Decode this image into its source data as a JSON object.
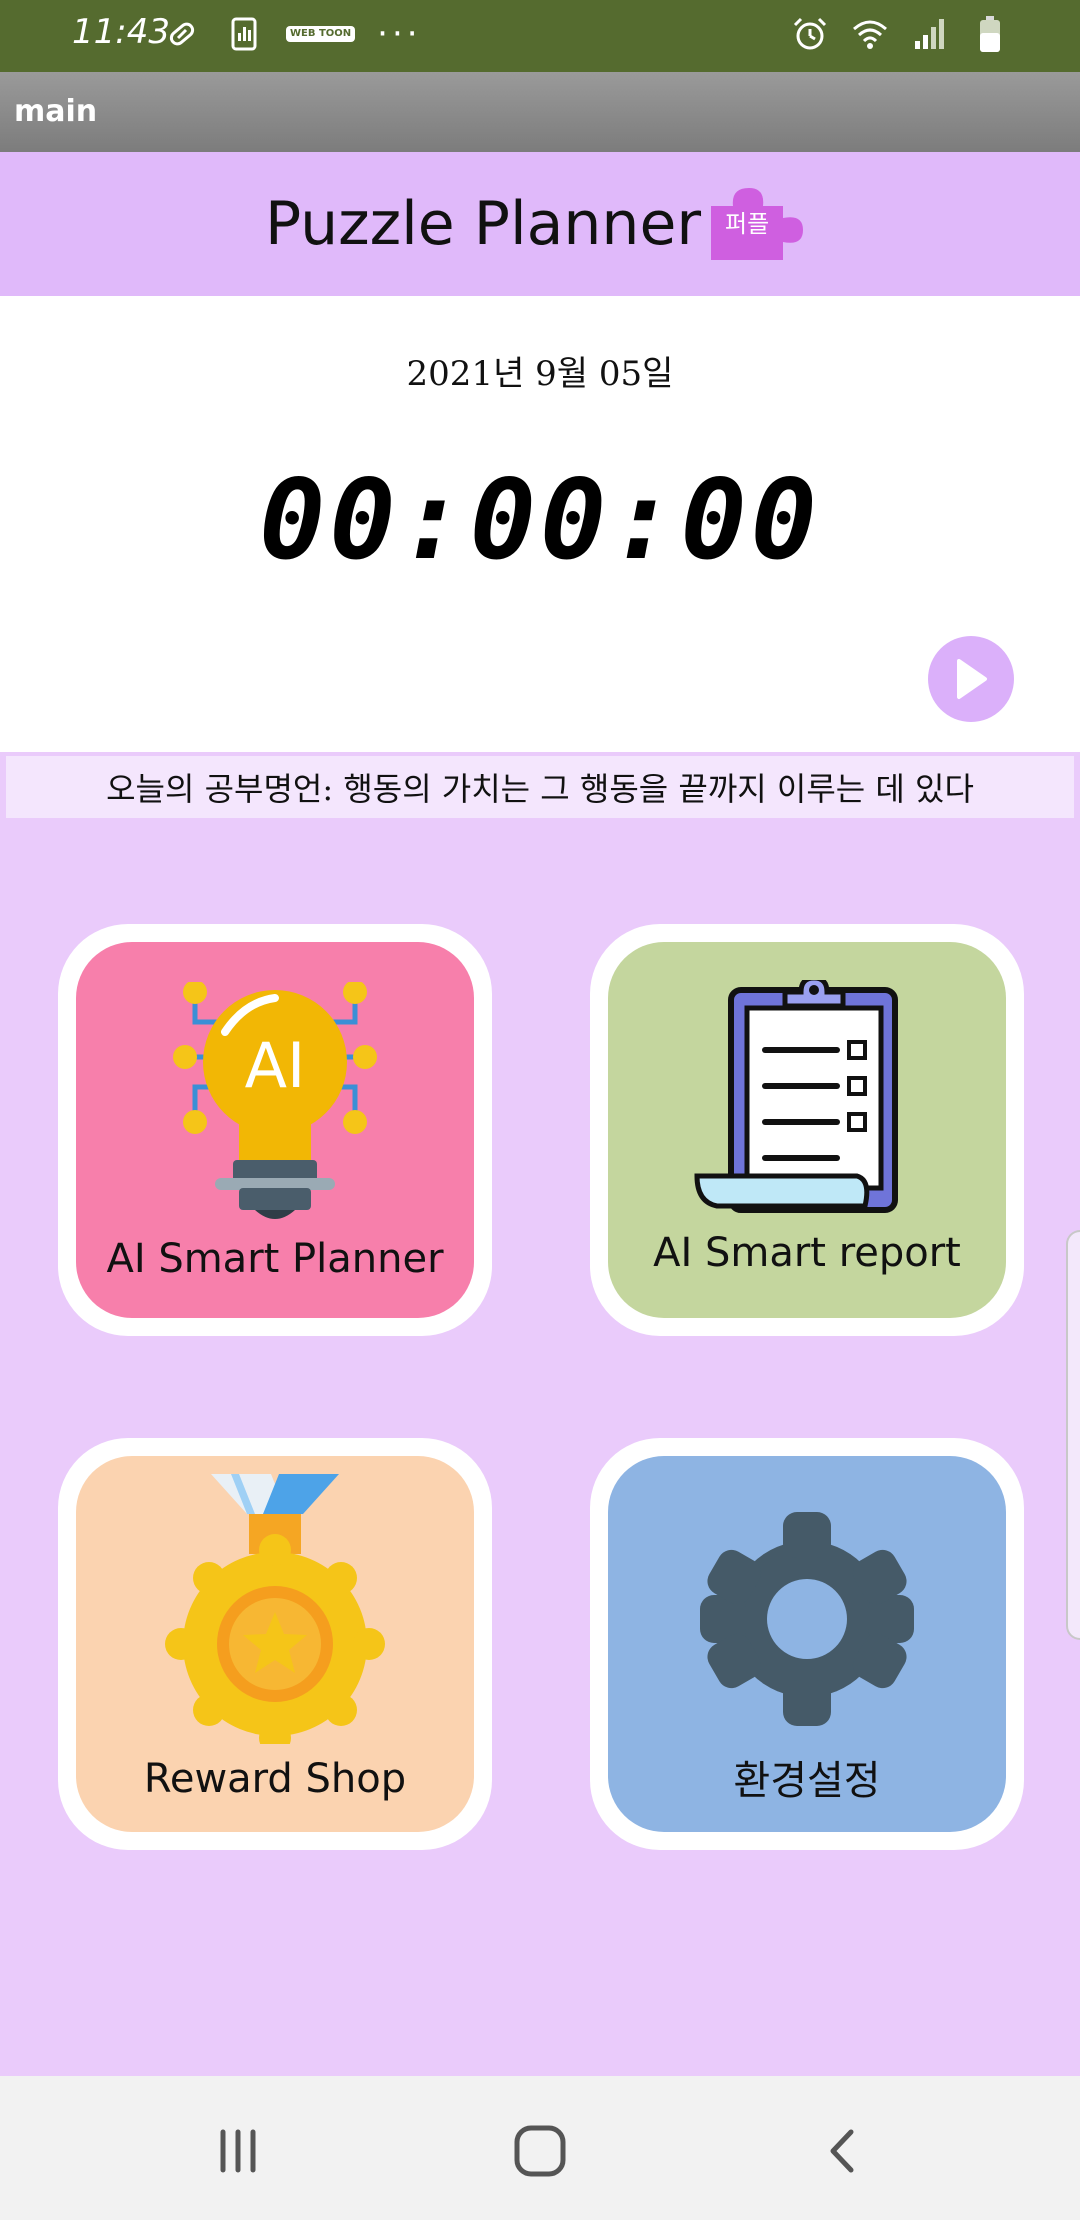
{
  "status_bar": {
    "time": "11:43",
    "left_icons": [
      "pill-icon",
      "chart-icon",
      "webtoon-icon",
      "more-icon"
    ],
    "webtoon_text": "WEB TOON",
    "more": "···",
    "right_icons": [
      "alarm-icon",
      "wifi-icon",
      "signal-icon",
      "battery-icon"
    ]
  },
  "app_bar": {
    "title": "main"
  },
  "header": {
    "title": "Puzzle Planner",
    "badge": "퍼플"
  },
  "timer": {
    "date": "2021년 9월 05일",
    "display": "00:00:00"
  },
  "quote": "오늘의 공부명언:  행동의 가치는 그 행동을 끝까지 이루는 데 있다",
  "tiles": [
    {
      "label": "AI Smart Planner",
      "icon": "ai-bulb-icon",
      "color": "#f77fab"
    },
    {
      "label": "AI Smart report",
      "icon": "clipboard-icon",
      "color": "#c4d69e"
    },
    {
      "label": "Reward Shop",
      "icon": "medal-icon",
      "color": "#fbd3b0"
    },
    {
      "label": "환경설정",
      "icon": "gear-icon",
      "color": "#8eb4e3"
    }
  ],
  "colors": {
    "status_bar": "#556b2f",
    "header": "#e0b9fa",
    "background": "#eacbfb",
    "accent": "#dbb0fa"
  }
}
